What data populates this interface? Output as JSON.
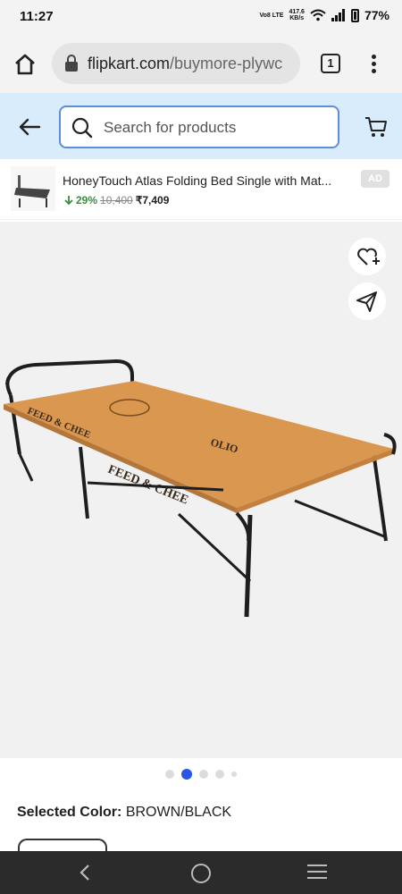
{
  "status_bar": {
    "time": "11:27",
    "network_top": "Vo8 LTE",
    "speed_top": "417.6",
    "speed_unit": "KB/s",
    "battery": "77%"
  },
  "browser": {
    "url_domain": "flipkart.com",
    "url_path": "/buymore-plywc",
    "tab_count": "1"
  },
  "search": {
    "placeholder": "Search for products"
  },
  "ad": {
    "title": "HoneyTouch Atlas Folding Bed Single with Mat...",
    "discount": "29%",
    "mrp": "10,400",
    "price": "₹7,409",
    "badge": "AD"
  },
  "gallery": {
    "dots_count": 5,
    "active_index": 1
  },
  "product": {
    "selected_color_label": "Selected Color:",
    "selected_color_value": "BROWN/BLACK"
  },
  "colors": {
    "accent_blue": "#2a55e5",
    "search_bg": "#d8ecfc",
    "discount_green": "#388e3c",
    "bed_wood": "#d9974f",
    "bed_frame": "#1e1e1e"
  },
  "watermark": "olx"
}
